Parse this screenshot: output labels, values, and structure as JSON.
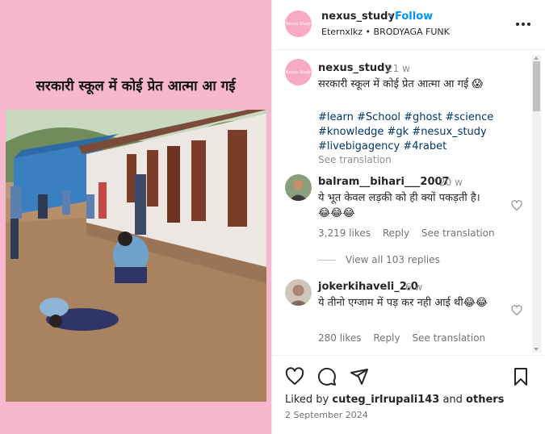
{
  "media": {
    "caption": "सरकारी स्कूल में कोई प्रेत आत्मा आ गई"
  },
  "header": {
    "username": "nexus_study",
    "dot": "•",
    "follow_label": "Follow",
    "subtitle_user": "Eternxlkz",
    "subtitle_sep": "•",
    "subtitle_audio": "BRODYAGA FUNK",
    "avatar_text": "Nexus Study",
    "more_icon": "more-horizontal-icon"
  },
  "caption": {
    "username": "nexus_study",
    "time": "21 w",
    "text": "सरकारी स्कूल में कोई प्रेत आत्मा आ गई 😱",
    "hashtags": "#learn #School #ghost #science #knowledge #gk #nesux_study #livebigagency #4rabet",
    "see_translation": "See translation"
  },
  "comments": [
    {
      "username": "balram__bihari___2007",
      "time": "20 w",
      "text": "ये भूत केवल लड़की को ही क्यों पकड़ती है। 😂😂😂",
      "likes": "3,219 likes",
      "reply": "Reply",
      "see_translation": "See translation",
      "view_replies": "View all 103 replies"
    },
    {
      "username": "jokerkihaveli_2.0",
      "time": "6 w",
      "text": "ये तीनो एग्जाम में पड़ कर नही आई थी😂😂",
      "likes": "280 likes",
      "reply": "Reply",
      "see_translation": "See translation"
    }
  ],
  "footer": {
    "liked_by_prefix": "Liked by ",
    "liked_by_user": "cuteg_irlrupali143",
    "liked_by_and": " and ",
    "liked_by_others": "others",
    "date": "2 September 2024"
  },
  "colors": {
    "accent": "#0095f6",
    "media_bg": "#f7b8cf",
    "hashtag": "#00376b"
  }
}
